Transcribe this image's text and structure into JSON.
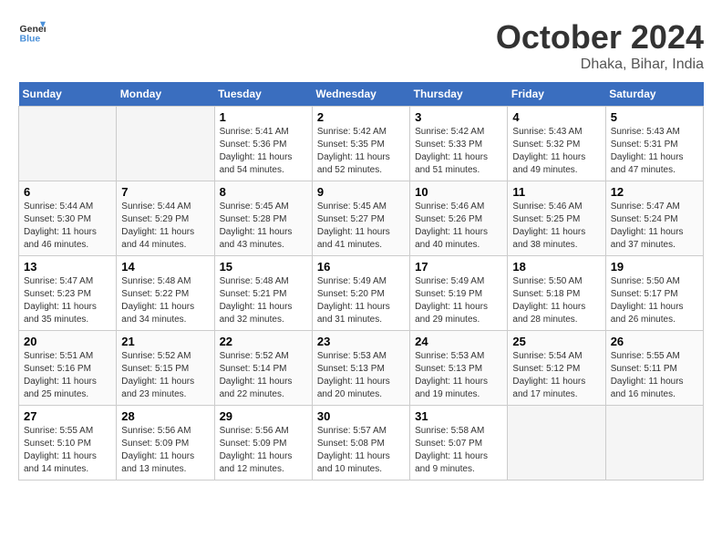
{
  "header": {
    "logo_general": "General",
    "logo_blue": "Blue",
    "month": "October 2024",
    "location": "Dhaka, Bihar, India"
  },
  "weekdays": [
    "Sunday",
    "Monday",
    "Tuesday",
    "Wednesday",
    "Thursday",
    "Friday",
    "Saturday"
  ],
  "weeks": [
    [
      {
        "day": "",
        "empty": true
      },
      {
        "day": "",
        "empty": true
      },
      {
        "day": "1",
        "sunrise": "5:41 AM",
        "sunset": "5:36 PM",
        "daylight": "11 hours and 54 minutes."
      },
      {
        "day": "2",
        "sunrise": "5:42 AM",
        "sunset": "5:35 PM",
        "daylight": "11 hours and 52 minutes."
      },
      {
        "day": "3",
        "sunrise": "5:42 AM",
        "sunset": "5:33 PM",
        "daylight": "11 hours and 51 minutes."
      },
      {
        "day": "4",
        "sunrise": "5:43 AM",
        "sunset": "5:32 PM",
        "daylight": "11 hours and 49 minutes."
      },
      {
        "day": "5",
        "sunrise": "5:43 AM",
        "sunset": "5:31 PM",
        "daylight": "11 hours and 47 minutes."
      }
    ],
    [
      {
        "day": "6",
        "sunrise": "5:44 AM",
        "sunset": "5:30 PM",
        "daylight": "11 hours and 46 minutes."
      },
      {
        "day": "7",
        "sunrise": "5:44 AM",
        "sunset": "5:29 PM",
        "daylight": "11 hours and 44 minutes."
      },
      {
        "day": "8",
        "sunrise": "5:45 AM",
        "sunset": "5:28 PM",
        "daylight": "11 hours and 43 minutes."
      },
      {
        "day": "9",
        "sunrise": "5:45 AM",
        "sunset": "5:27 PM",
        "daylight": "11 hours and 41 minutes."
      },
      {
        "day": "10",
        "sunrise": "5:46 AM",
        "sunset": "5:26 PM",
        "daylight": "11 hours and 40 minutes."
      },
      {
        "day": "11",
        "sunrise": "5:46 AM",
        "sunset": "5:25 PM",
        "daylight": "11 hours and 38 minutes."
      },
      {
        "day": "12",
        "sunrise": "5:47 AM",
        "sunset": "5:24 PM",
        "daylight": "11 hours and 37 minutes."
      }
    ],
    [
      {
        "day": "13",
        "sunrise": "5:47 AM",
        "sunset": "5:23 PM",
        "daylight": "11 hours and 35 minutes."
      },
      {
        "day": "14",
        "sunrise": "5:48 AM",
        "sunset": "5:22 PM",
        "daylight": "11 hours and 34 minutes."
      },
      {
        "day": "15",
        "sunrise": "5:48 AM",
        "sunset": "5:21 PM",
        "daylight": "11 hours and 32 minutes."
      },
      {
        "day": "16",
        "sunrise": "5:49 AM",
        "sunset": "5:20 PM",
        "daylight": "11 hours and 31 minutes."
      },
      {
        "day": "17",
        "sunrise": "5:49 AM",
        "sunset": "5:19 PM",
        "daylight": "11 hours and 29 minutes."
      },
      {
        "day": "18",
        "sunrise": "5:50 AM",
        "sunset": "5:18 PM",
        "daylight": "11 hours and 28 minutes."
      },
      {
        "day": "19",
        "sunrise": "5:50 AM",
        "sunset": "5:17 PM",
        "daylight": "11 hours and 26 minutes."
      }
    ],
    [
      {
        "day": "20",
        "sunrise": "5:51 AM",
        "sunset": "5:16 PM",
        "daylight": "11 hours and 25 minutes."
      },
      {
        "day": "21",
        "sunrise": "5:52 AM",
        "sunset": "5:15 PM",
        "daylight": "11 hours and 23 minutes."
      },
      {
        "day": "22",
        "sunrise": "5:52 AM",
        "sunset": "5:14 PM",
        "daylight": "11 hours and 22 minutes."
      },
      {
        "day": "23",
        "sunrise": "5:53 AM",
        "sunset": "5:13 PM",
        "daylight": "11 hours and 20 minutes."
      },
      {
        "day": "24",
        "sunrise": "5:53 AM",
        "sunset": "5:13 PM",
        "daylight": "11 hours and 19 minutes."
      },
      {
        "day": "25",
        "sunrise": "5:54 AM",
        "sunset": "5:12 PM",
        "daylight": "11 hours and 17 minutes."
      },
      {
        "day": "26",
        "sunrise": "5:55 AM",
        "sunset": "5:11 PM",
        "daylight": "11 hours and 16 minutes."
      }
    ],
    [
      {
        "day": "27",
        "sunrise": "5:55 AM",
        "sunset": "5:10 PM",
        "daylight": "11 hours and 14 minutes."
      },
      {
        "day": "28",
        "sunrise": "5:56 AM",
        "sunset": "5:09 PM",
        "daylight": "11 hours and 13 minutes."
      },
      {
        "day": "29",
        "sunrise": "5:56 AM",
        "sunset": "5:09 PM",
        "daylight": "11 hours and 12 minutes."
      },
      {
        "day": "30",
        "sunrise": "5:57 AM",
        "sunset": "5:08 PM",
        "daylight": "11 hours and 10 minutes."
      },
      {
        "day": "31",
        "sunrise": "5:58 AM",
        "sunset": "5:07 PM",
        "daylight": "11 hours and 9 minutes."
      },
      {
        "day": "",
        "empty": true
      },
      {
        "day": "",
        "empty": true
      }
    ]
  ]
}
